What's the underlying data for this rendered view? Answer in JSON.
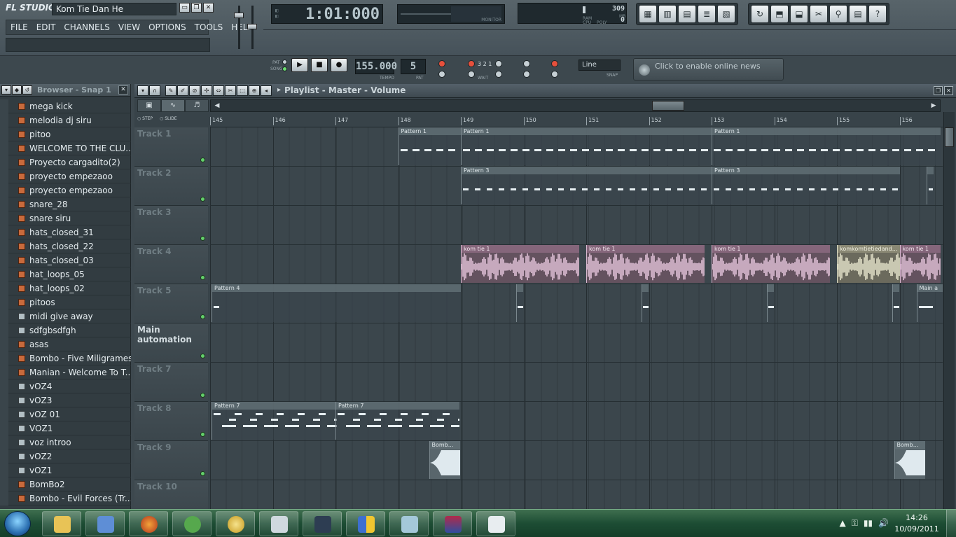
{
  "app": {
    "logo": "FL STUDIO",
    "song_title": "Kom Tie Dan He",
    "window_buttons": [
      "▭",
      "❐",
      "✕"
    ]
  },
  "menu": [
    "FILE",
    "EDIT",
    "CHANNELS",
    "VIEW",
    "OPTIONS",
    "TOOLS",
    "HELP"
  ],
  "time_display": {
    "value": "1:01:000"
  },
  "monitor_label": "MONITOR",
  "cpu_panel": {
    "ram_value": "309",
    "poly_value": "0",
    "ram_label": "RAM",
    "cpu_label": "CPU",
    "poly_label": "POLY",
    "mb_label": "MB"
  },
  "transport": {
    "pat_label": "PAT",
    "song_label": "SONG",
    "play_icon": "▶",
    "stop_icon": "■",
    "record_icon": "●",
    "tempo_value": "155.000",
    "tempo_label": "TEMPO",
    "pattern_value": "5",
    "pattern_label": "PAT",
    "wait_label": "WAIT",
    "countdown_label": "3 2 1"
  },
  "snap": {
    "value": "Line",
    "label": "SNAP"
  },
  "news": {
    "text": "Click to enable online news"
  },
  "toolbar_icons_left": [
    "playlist-icon",
    "step-sequencer-icon",
    "piano-roll-icon",
    "browser-icon",
    "mixer-icon"
  ],
  "toolbar_icons_right": [
    "undo-icon",
    "save-icon",
    "export-icon",
    "cut-icon",
    "search-icon",
    "plugin-icon",
    "help-icon"
  ],
  "toolbar_icon_glyphs": [
    "▦",
    "▥",
    "▤",
    "≣",
    "▧",
    "↻",
    "⬒",
    "⬓",
    "✂",
    "⚲",
    "▤",
    "?"
  ],
  "browser": {
    "title": "Browser - Snap 1",
    "close": "✕",
    "items": [
      {
        "label": "mega kick",
        "kind": "audio"
      },
      {
        "label": "melodia dj siru",
        "kind": "audio"
      },
      {
        "label": "pitoo",
        "kind": "audio"
      },
      {
        "label": "WELCOME TO THE CLU...",
        "kind": "audio"
      },
      {
        "label": "Proyecto cargadito(2)",
        "kind": "audio"
      },
      {
        "label": "proyecto empezaoo",
        "kind": "audio"
      },
      {
        "label": "proyecto empezaoo",
        "kind": "audio"
      },
      {
        "label": "snare_28",
        "kind": "audio"
      },
      {
        "label": "snare siru",
        "kind": "audio"
      },
      {
        "label": "hats_closed_31",
        "kind": "audio"
      },
      {
        "label": "hats_closed_22",
        "kind": "audio"
      },
      {
        "label": "hats_closed_03",
        "kind": "audio"
      },
      {
        "label": "hat_loops_05",
        "kind": "audio"
      },
      {
        "label": "hat_loops_02",
        "kind": "audio"
      },
      {
        "label": "pitoos",
        "kind": "audio"
      },
      {
        "label": "midi give away",
        "kind": "midi"
      },
      {
        "label": "sdfgbsdfgh",
        "kind": "midi"
      },
      {
        "label": "asas",
        "kind": "audio"
      },
      {
        "label": "Bombo - Five Miligrames...",
        "kind": "audio"
      },
      {
        "label": "Manian - Welcome To T...",
        "kind": "audio"
      },
      {
        "label": "vOZ4",
        "kind": "midi"
      },
      {
        "label": "vOZ3",
        "kind": "midi"
      },
      {
        "label": "vOZ 01",
        "kind": "midi"
      },
      {
        "label": "VOZ1",
        "kind": "midi"
      },
      {
        "label": "voz introo",
        "kind": "midi"
      },
      {
        "label": "vOZ2",
        "kind": "midi"
      },
      {
        "label": "vOZ1",
        "kind": "midi"
      },
      {
        "label": "BomBo2",
        "kind": "audio"
      },
      {
        "label": "Bombo - Evil Forces (Tr...",
        "kind": "audio"
      }
    ]
  },
  "playlist": {
    "title": "Playlist - Master - Volume",
    "step_label": "STEP",
    "slide_label": "SLIDE",
    "ruler": [
      "145",
      "146",
      "147",
      "148",
      "149",
      "150",
      "151",
      "152",
      "153",
      "154",
      "155",
      "156"
    ],
    "tracks": [
      "Track 1",
      "Track 2",
      "Track 3",
      "Track 4",
      "Track 5",
      "Main automation",
      "Track 7",
      "Track 8",
      "Track 9",
      "Track 10"
    ],
    "clip_labels": {
      "pattern1": "Pattern 1",
      "pattern3": "Pattern 3",
      "pattern4": "Pattern 4",
      "pattern7": "Pattern 7",
      "komtie": "kom tie 1",
      "komfull": "komkomtietiedand...",
      "bombo": "Bomb...",
      "maina": "Main a"
    }
  },
  "taskbar": {
    "time": "14:26",
    "date": "10/09/2011",
    "tray_icons": [
      "▲",
      "⚿",
      "▮▮",
      "🔊"
    ]
  }
}
